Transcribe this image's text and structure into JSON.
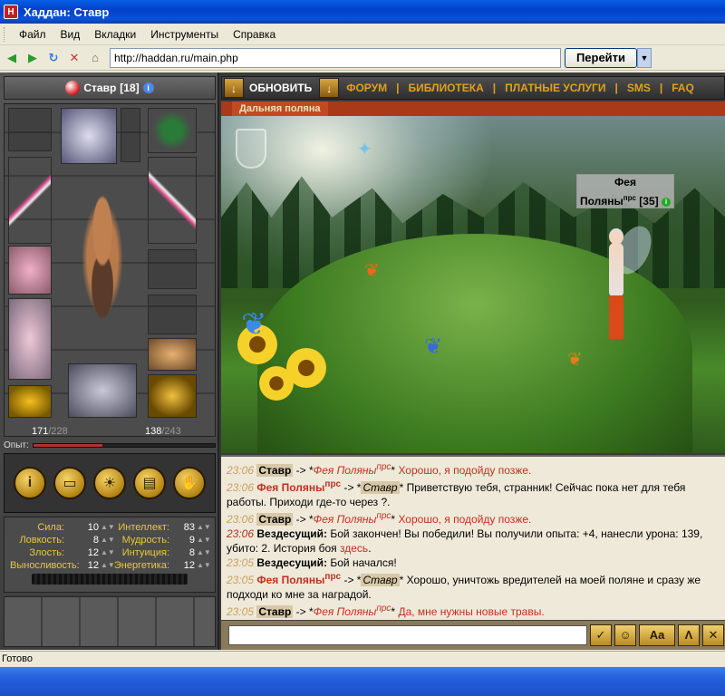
{
  "window": {
    "title": "Хаддан: Ставр",
    "app_icon": "shield-icon"
  },
  "menu": {
    "items": [
      "Файл",
      "Вид",
      "Вкладки",
      "Инструменты",
      "Справка"
    ]
  },
  "address": {
    "url": "http://haddan.ru/main.php",
    "go_label": "Перейти"
  },
  "character": {
    "name": "Ставр",
    "level": "[18]",
    "hp": "171",
    "hp_max": "/228",
    "mana": "138",
    "mana_max": "/243",
    "xp_label": "Опыт:",
    "xp_fraction": 0.38
  },
  "stats": {
    "rows": [
      {
        "l": "Сила:",
        "v": "10",
        "r": "Интеллект:",
        "rv": "83"
      },
      {
        "l": "Ловкость:",
        "v": "8",
        "r": "Мудрость:",
        "rv": "9"
      },
      {
        "l": "Злость:",
        "v": "12",
        "r": "Интуиция:",
        "rv": "8"
      },
      {
        "l": "Выносливость:",
        "v": "12",
        "r": "Энергетика:",
        "rv": "12"
      }
    ]
  },
  "topnav": {
    "refresh": "ОБНОВИТЬ",
    "links": [
      "ФОРУМ",
      "БИБЛИОТЕКА",
      "ПЛАТНЫЕ УСЛУГИ",
      "SMS",
      "FAQ"
    ]
  },
  "location": {
    "title": "Дальняя поляна"
  },
  "npc": {
    "name1": "Фея",
    "name2": "Поляны",
    "tag": "прс",
    "level": "[35]"
  },
  "chat": [
    {
      "time": "23:06",
      "html": "<span class='nm'>Ставр</span> -&gt; *<span class='npci'>Фея Поляны<sup>прс</sup></span>* <span class='red'>Хорошо, я подойду позже.</span>"
    },
    {
      "time": "23:06",
      "html": "<span class='npc'>Фея Поляны<sup>прс</sup></span> -&gt; *<span class='nmi'>Ставр</span>* Приветствую тебя, странник! Сейчас пока нет для тебя работы. Приходи где-то через ?."
    },
    {
      "time": "23:06",
      "html": "<span class='nm'>Ставр</span> -&gt; *<span class='npci'>Фея Поляны<sup>прс</sup></span>* <span class='red'>Хорошо, я подойду позже.</span>"
    },
    {
      "time": "23:06",
      "html": "<span class='sys'>Вездесущий:</span> Бой закончен! Вы победили! Вы получили опыта: +4, нанесли урона: 139, убито: 2. История боя <span class='red'>здесь</span>."
    },
    {
      "time": "23:05",
      "html": "<span class='sys'>Вездесущий:</span> Бой начался!"
    },
    {
      "time": "23:05",
      "html": "<span class='npc'>Фея Поляны<sup>прс</sup></span> -&gt; *<span class='nmi'>Ставр</span>* Хорошо, уничтожь вредителей на моей поляне и сразу же подходи ко мне за наградой."
    },
    {
      "time": "23:05",
      "html": "<span class='nm'>Ставр</span> -&gt; *<span class='npci'>Фея Поляны<sup>прс</sup></span>* <span class='red'>Да, мне нужны новые травы.</span>"
    }
  ],
  "status": {
    "text": "Готово"
  }
}
